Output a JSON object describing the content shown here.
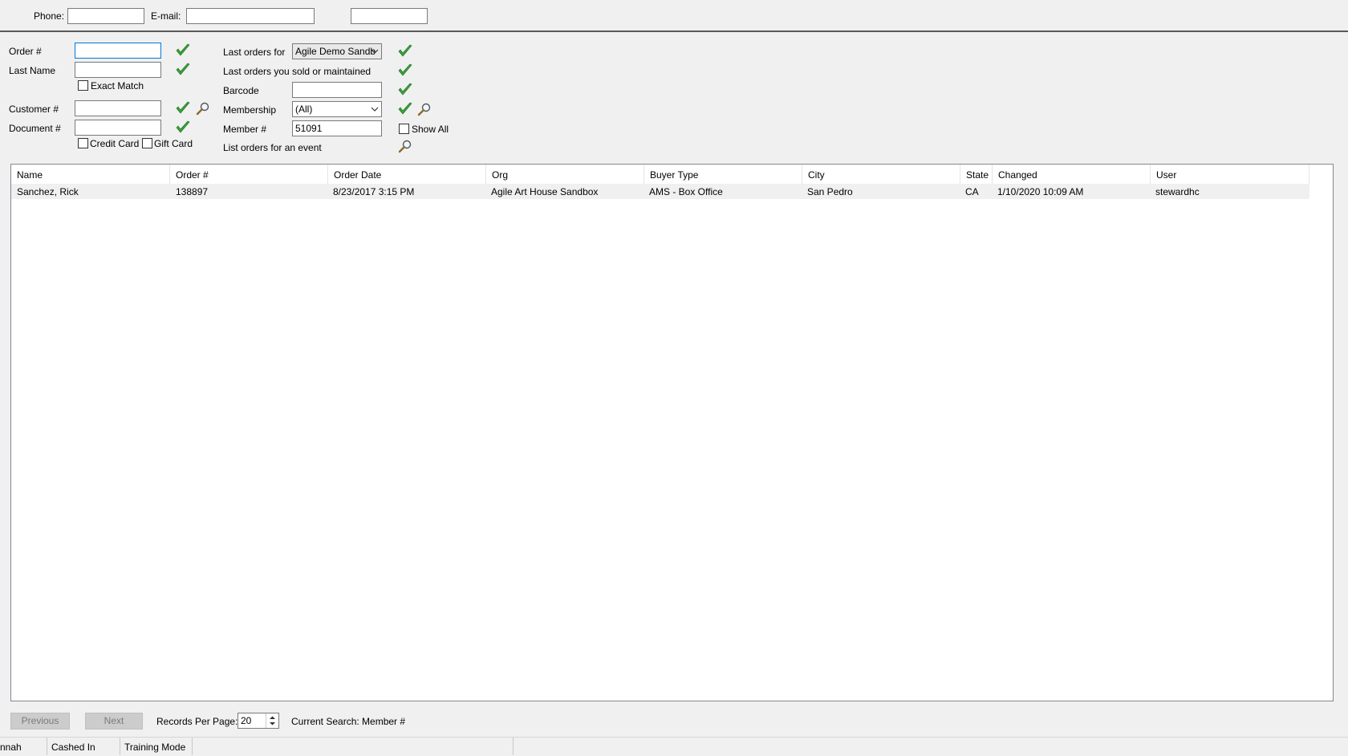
{
  "top_bar": {
    "phone_label": "Phone:",
    "phone_value": "",
    "email_label": "E-mail:",
    "email_value": "",
    "extra_value": ""
  },
  "search": {
    "order_label": "Order #",
    "order_value": "",
    "last_name_label": "Last Name",
    "last_name_value": "",
    "exact_match_label": "Exact Match",
    "customer_label": "Customer #",
    "customer_value": "",
    "document_label": "Document #",
    "document_value": "",
    "credit_card_label": "Credit Card",
    "gift_card_label": "Gift Card",
    "last_orders_for_label": "Last orders for",
    "last_orders_for_value": "Agile Demo Sandb",
    "last_orders_sold_label": "Last orders you sold or maintained",
    "barcode_label": "Barcode",
    "barcode_value": "",
    "membership_label": "Membership",
    "membership_value": "(All)",
    "member_label": "Member #",
    "member_value": "51091",
    "show_all_label": "Show All",
    "event_label": "List orders for an event"
  },
  "grid": {
    "columns": [
      "Name",
      "Order #",
      "Order Date",
      "Org",
      "Buyer Type",
      "City",
      "State",
      "Changed",
      "User"
    ],
    "rows": [
      [
        "Sanchez, Rick",
        "138897",
        "8/23/2017 3:15 PM",
        "Agile Art House Sandbox",
        "AMS - Box Office",
        "San Pedro",
        "CA",
        "1/10/2020 10:09 AM",
        "stewardhc"
      ]
    ]
  },
  "footer": {
    "previous_label": "Previous",
    "next_label": "Next",
    "records_per_page_label": "Records Per Page:",
    "records_per_page_value": "20",
    "current_search": "Current Search: Member #"
  },
  "status_bar": {
    "user_fragment": "nnah",
    "cashed_in": "Cashed In",
    "training_mode": "Training Mode"
  },
  "colors": {
    "window_bg": "#f0f0f0",
    "check_green": "#3aa33a",
    "focus_border": "#0078d7",
    "selected_row": "#f0f0f0"
  }
}
